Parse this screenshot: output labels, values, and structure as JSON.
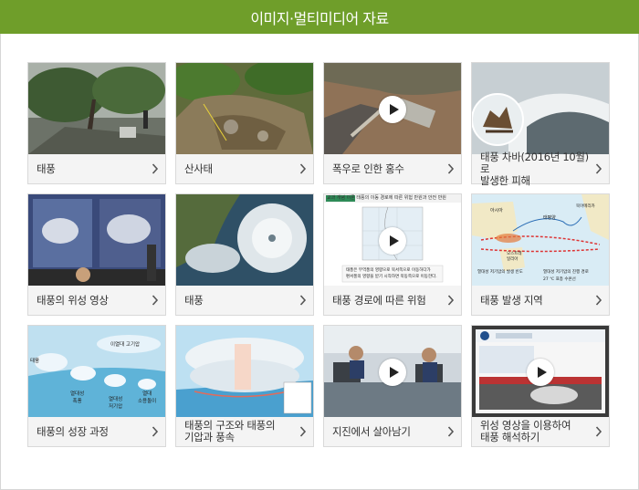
{
  "header": {
    "title": "이미지·멀티미디어 자료"
  },
  "cards": [
    {
      "label": "태풍",
      "type": "image",
      "thumb": "typhoon-tree"
    },
    {
      "label": "산사태",
      "type": "image",
      "thumb": "landslide"
    },
    {
      "label": "폭우로 인한 홍수",
      "type": "video",
      "thumb": "flood"
    },
    {
      "label": "태풍 차바(2016년 10월)로\n발생한 피해",
      "type": "image",
      "thumb": "chaba-damage"
    },
    {
      "label": "태풍의 위성 영상",
      "type": "image",
      "thumb": "satellite-forecast"
    },
    {
      "label": "태풍",
      "type": "image",
      "thumb": "typhoon-satellite"
    },
    {
      "label": "태풍 경로에 따른 위험",
      "type": "video",
      "thumb": "typhoon-path"
    },
    {
      "label": "태풍 발생 지역",
      "type": "image",
      "thumb": "typhoon-region-map"
    },
    {
      "label": "태풍의 성장 과정",
      "type": "image",
      "thumb": "typhoon-growth"
    },
    {
      "label": "태풍의 구조와 태풍의\n기압과 풍속",
      "type": "image",
      "thumb": "typhoon-structure"
    },
    {
      "label": "지진에서 살아남기",
      "type": "video",
      "thumb": "earthquake-office"
    },
    {
      "label": "위성 영상을 이용하여\n태풍 해석하기",
      "type": "video",
      "thumb": "satellite-monitor"
    }
  ],
  "thumb_text": {
    "path_header": "교과 개념 이론   태풍의 이동 경로에 따른 위험 반원과 안전 반원",
    "path_note_1": "태풍은 무역풍의 영향으로 북서쪽으로 이동하다가",
    "path_note_2": "편서풍의 영향을 받기 시작하면 북동쪽으로 이동한다.",
    "map_asia": "아시아",
    "map_pacific": "태평양",
    "map_north_america": "북아메리카",
    "map_australia": "오스트레일리아",
    "map_legend_1": "열대성 저기압의 발생 빈도",
    "map_legend_2": "열대성 저기압의 진행 경로",
    "map_legend_3": "27 ℃ 표층 수온선",
    "growth_high": "이열대 고기압",
    "growth_typhoon": "태풍",
    "growth_1": "열대성\n폭풍",
    "growth_2": "열대성\n저기압",
    "growth_3": "열대\n소용돌이"
  },
  "colors": {
    "header": "#6f9e2a",
    "card_bg": "#f4f4f4",
    "border": "#d9d9d9",
    "text": "#333333"
  }
}
